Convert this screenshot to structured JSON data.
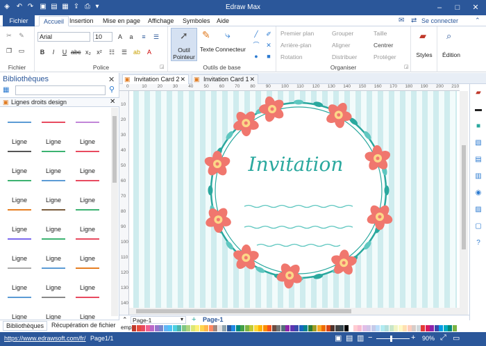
{
  "app": {
    "title": "Edraw Max",
    "connect": "Se connecter"
  },
  "tabs": [
    "Fichier",
    "Accueil",
    "Insertion",
    "Mise en page",
    "Affichage",
    "Symboles",
    "Aide"
  ],
  "ribbon": {
    "groups": [
      "Fichier",
      "Police",
      "Outils de base",
      "Organiser"
    ],
    "font": "Arial",
    "size": "10",
    "outil": "Outil",
    "pointeur": "Pointeur",
    "texte": "Texte",
    "connecteur": "Connecteur",
    "organiser": [
      "Premier plan",
      "Arrière-plan",
      "Rotation",
      "Grouper",
      "Aligner",
      "Distribuer",
      "Taille",
      "Centrer",
      "Protéger"
    ],
    "styles": "Styles",
    "edition": "Édition"
  },
  "library": {
    "title": "Bibliothèques",
    "category": "Lignes droits design",
    "shape_label": "Ligne",
    "colors": [
      "#5b9bd5",
      "#e84a5f",
      "#c285d8",
      "#555555",
      "#3cb371",
      "#e84a5f",
      "#3cb371",
      "#5b9bd5",
      "#e84a5f",
      "#e67e22",
      "#7a5c3c",
      "#3cb371",
      "#7b68ee",
      "#3cb371",
      "#e84a5f",
      "#aaaaaa",
      "#5b9bd5",
      "#e67e22",
      "#5b9bd5",
      "#888888",
      "#e84a5f"
    ],
    "footer_tabs": [
      "Bibliothèques",
      "Récupération de fichier"
    ]
  },
  "doc_tabs": [
    "Invitation Card 2",
    "Invitation Card 1"
  ],
  "ruler_h": [
    "0",
    "10",
    "20",
    "30",
    "40",
    "50",
    "60",
    "70",
    "80",
    "90",
    "100",
    "110",
    "120",
    "130",
    "140",
    "150",
    "160",
    "170",
    "180",
    "190",
    "200",
    "210"
  ],
  "ruler_v": [
    "10",
    "20",
    "30",
    "40",
    "50",
    "60",
    "70",
    "80",
    "90",
    "100",
    "110",
    "120",
    "130",
    "140"
  ],
  "card": {
    "heading": "Invitation"
  },
  "pages": {
    "left": "Page-1",
    "right": "Page-1"
  },
  "palette_label": "emp",
  "status": {
    "url": "https://www.edrawsoft.com/fr/",
    "page": "Page1/1",
    "zoom": "90%"
  }
}
